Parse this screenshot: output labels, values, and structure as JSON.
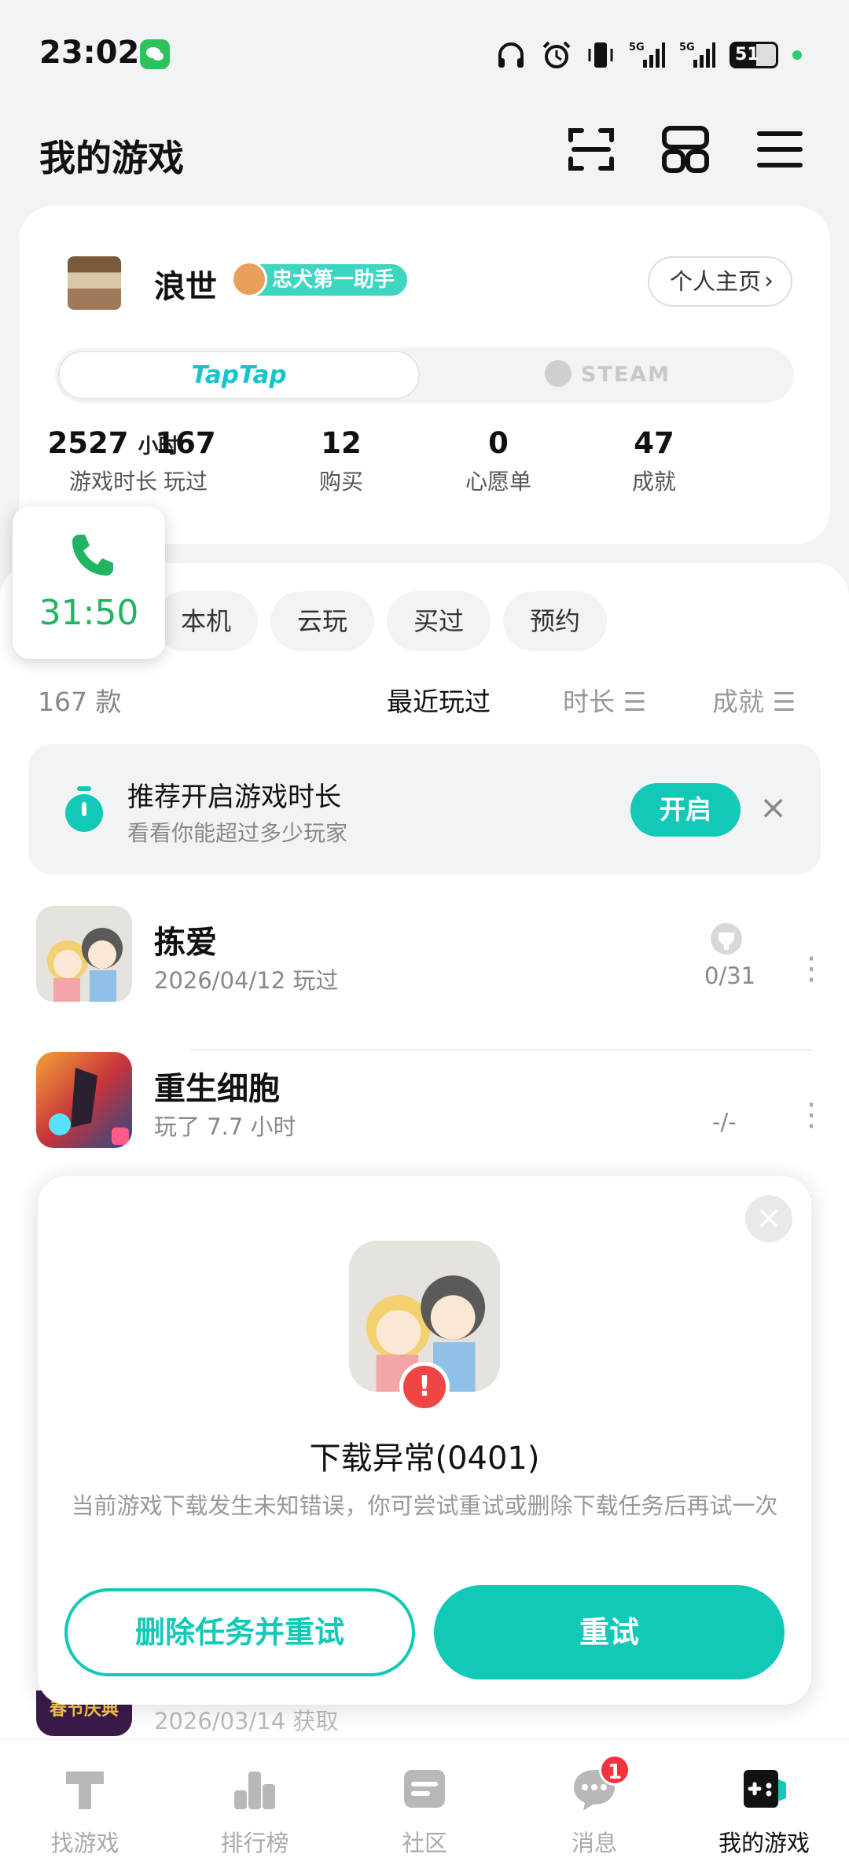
{
  "status_bar": {
    "time": "23:02",
    "battery": "51",
    "icons": [
      "headphones-icon",
      "alarm-icon",
      "vibrate-icon",
      "5g-signal-icon",
      "5g-signal-icon"
    ]
  },
  "header": {
    "title": "我的游戏"
  },
  "profile": {
    "username": "浪世",
    "badge": "忠犬第一助手",
    "homepage_label": "个人主页",
    "platforms": {
      "taptap": "TapTap",
      "steam": "STEAM"
    },
    "stats": [
      {
        "value": "2527",
        "unit": "小时",
        "label": "游戏时长"
      },
      {
        "value": "167",
        "label": "玩过"
      },
      {
        "value": "12",
        "label": "购买"
      },
      {
        "value": "0",
        "label": "心愿单"
      },
      {
        "value": "47",
        "label": "成就"
      }
    ]
  },
  "call": {
    "duration": "31:50"
  },
  "filters": {
    "chips": [
      "本机",
      "云玩",
      "买过",
      "预约"
    ],
    "count": "167 款",
    "sort": {
      "recent": "最近玩过",
      "duration": "时长",
      "achievement": "成就"
    }
  },
  "recommend": {
    "title": "推荐开启游戏时长",
    "subtitle": "看看你能超过多少玩家",
    "button": "开启"
  },
  "games": [
    {
      "name": "拣爱",
      "sub": "2026/04/12 玩过",
      "achievement": "0/31"
    },
    {
      "name": "重生细胞",
      "sub": "玩了 7.7 小时",
      "achievement": "-/-"
    }
  ],
  "peek_row": {
    "sub": "2026/03/14 获取",
    "icon_text": "春节庆典"
  },
  "dialog": {
    "title": "下载异常(0401)",
    "message": "当前游戏下载发生未知错误，你可尝试重试或删除下载任务后再试一次",
    "delete_retry_label": "删除任务并重试",
    "retry_label": "重试"
  },
  "bottom_nav": [
    {
      "label": "找游戏",
      "icon": "find-games-icon"
    },
    {
      "label": "排行榜",
      "icon": "ranking-icon"
    },
    {
      "label": "社区",
      "icon": "community-icon"
    },
    {
      "label": "消息",
      "icon": "message-icon",
      "badge": "1"
    },
    {
      "label": "我的游戏",
      "icon": "my-games-icon",
      "active": true
    }
  ],
  "colors": {
    "accent": "#12c9b8",
    "call_green": "#20b463",
    "error_red": "#f04545"
  }
}
